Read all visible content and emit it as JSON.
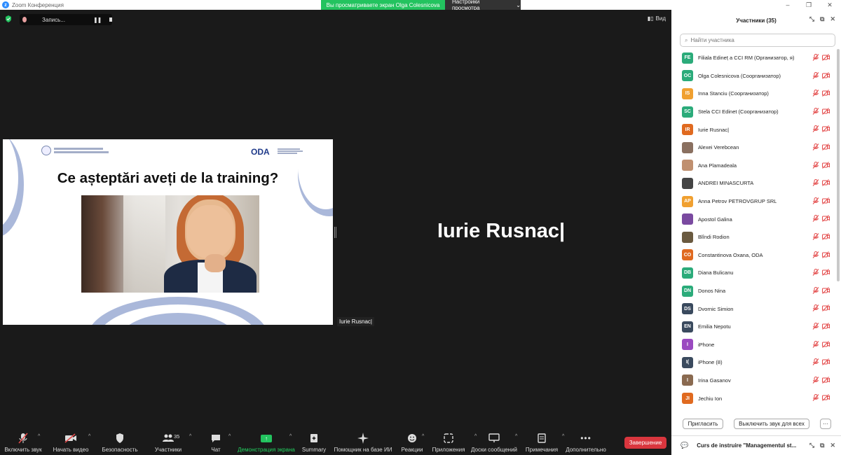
{
  "window": {
    "title": "Zoom Конференция",
    "banner": "Вы просматриваете экран Olga Colesnicova",
    "view_settings": "Настройки просмотра"
  },
  "meeting": {
    "recording_label": "Запись...",
    "view_label": "Вид",
    "slide_title": "Ce așteptări aveți de la training?",
    "slide_logo": "ODA",
    "sharer_name": "Iurie Rusnac|",
    "speaker_name": "Iurie Rusnac|"
  },
  "toolbar": {
    "unmute": "Включить звук",
    "start_video": "Начать видео",
    "security": "Безопасность",
    "participants": "Участники",
    "participants_count": "35",
    "chat": "Чат",
    "share": "Демонстрация экрана",
    "summary": "Summary",
    "ai_companion": "Помощник на базе ИИ",
    "reactions": "Реакции",
    "apps": "Приложения",
    "whiteboards": "Доски сообщений",
    "notes": "Примечания",
    "more": "Дополнительно",
    "end": "Завершение"
  },
  "panel": {
    "title": "Участники (35)",
    "search_placeholder": "Найти участника",
    "participants": [
      {
        "initials": "FE",
        "name": "Filiala Edineț a CCI RM (Организатор, я)",
        "color": "#2bab7a"
      },
      {
        "initials": "OC",
        "name": "Olga Colesnicova (Соорганизатор)",
        "color": "#2bab7a"
      },
      {
        "initials": "IS",
        "name": "Inna Stanciu (Соорганизатор)",
        "color": "#f0a030"
      },
      {
        "initials": "SC",
        "name": "Stela CCI Edinet (Соорганизатор)",
        "color": "#2bab7a"
      },
      {
        "initials": "IR",
        "name": "Iurie Rusnac|",
        "color": "#e06a20"
      },
      {
        "initials": "",
        "name": "Alexei Verebcean",
        "color": "#8a7060"
      },
      {
        "initials": "",
        "name": "Ana Plamadeala",
        "color": "#c09070"
      },
      {
        "initials": "",
        "name": "ANDREI MINASCURTA",
        "color": "#444444"
      },
      {
        "initials": "AP",
        "name": "Anna Petrov PETROVGRUP SRL",
        "color": "#f0a030"
      },
      {
        "initials": "",
        "name": "Apostol Galina",
        "color": "#7a4aa0"
      },
      {
        "initials": "",
        "name": "Blîndi Rodion",
        "color": "#6a5a40"
      },
      {
        "initials": "CO",
        "name": "Constantinova Oxana, ODA",
        "color": "#e06a20"
      },
      {
        "initials": "DB",
        "name": "Diana Bulicanu",
        "color": "#2bab7a"
      },
      {
        "initials": "DN",
        "name": "Donos Nina",
        "color": "#2bab7a"
      },
      {
        "initials": "DS",
        "name": "Dvornic Simion",
        "color": "#3a4a5e"
      },
      {
        "initials": "EN",
        "name": "Emilia Nepotu",
        "color": "#3a4a5e"
      },
      {
        "initials": "I",
        "name": "iPhone",
        "color": "#9a4ac0"
      },
      {
        "initials": "I(",
        "name": "iPhone (8)",
        "color": "#3a4a5e"
      },
      {
        "initials": "I",
        "name": "Irina Gasanov",
        "color": "#8a6a50"
      },
      {
        "initials": "JI",
        "name": "Jechiu Ion",
        "color": "#e06a20"
      }
    ],
    "invite": "Пригласить",
    "mute_all": "Выключить звук для всех",
    "more": "···",
    "chat_title": "Curs de instruire \"Managementul st..."
  }
}
